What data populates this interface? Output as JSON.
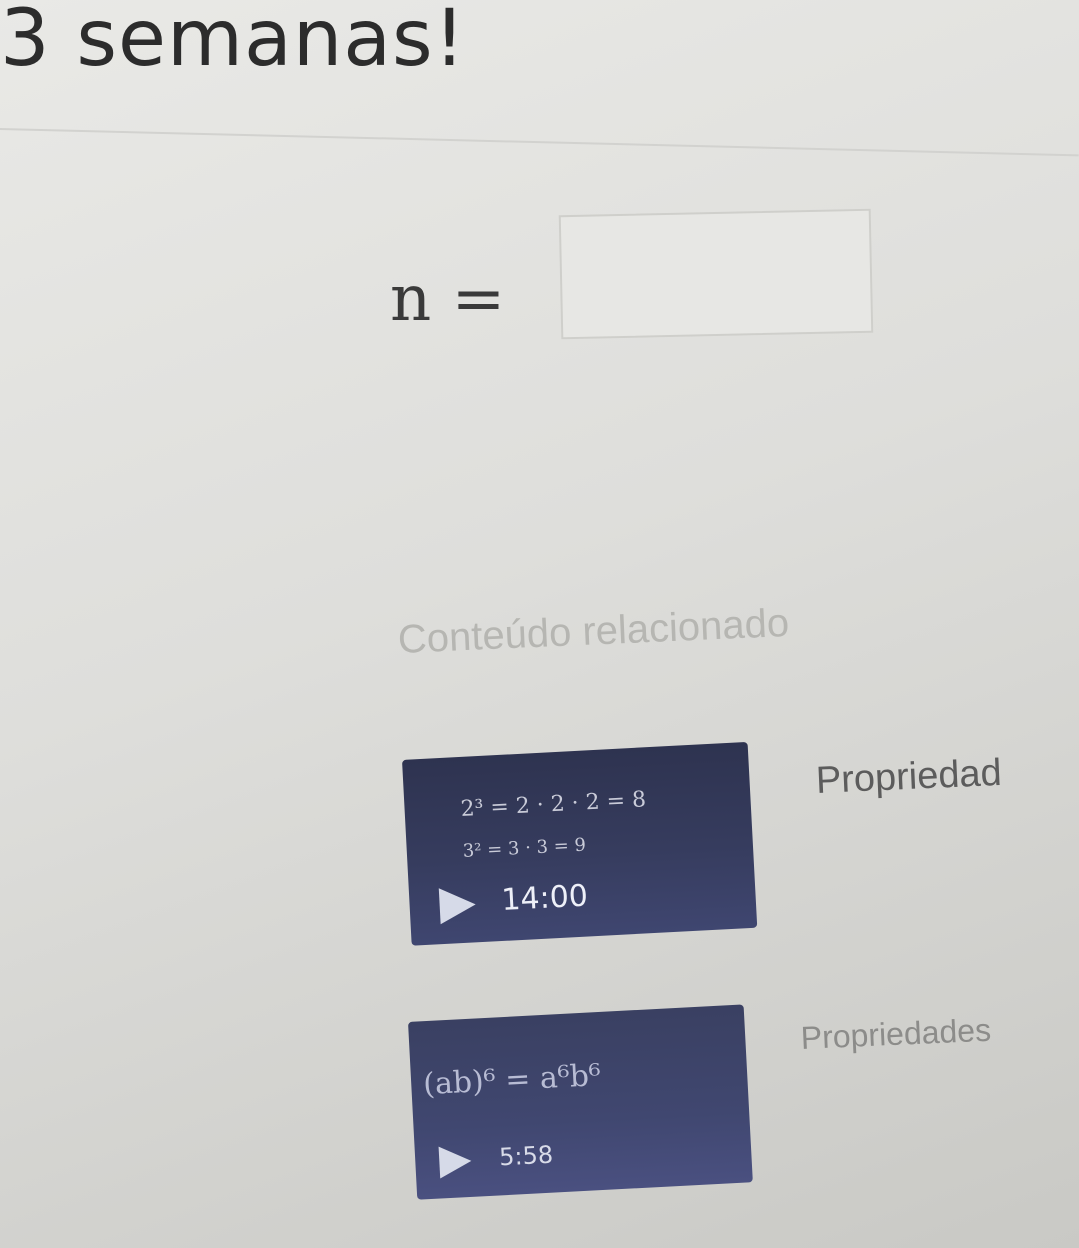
{
  "header": {
    "title": "3 semanas!"
  },
  "question": {
    "variable": "n",
    "operator": "=",
    "answer_value": ""
  },
  "related": {
    "heading": "Conteúdo relacionado",
    "videos": [
      {
        "thumbnail_lines": [
          "2³ = 2 · 2 · 2 = 8",
          "3² = 3 · 3 = 9"
        ],
        "duration": "14:00",
        "title": "Propriedad"
      },
      {
        "thumbnail_lines": [
          "(ab)⁶ = a⁶b⁶"
        ],
        "duration": "5:58",
        "title": "Propriedades"
      }
    ]
  },
  "colors": {
    "thumbnail_bg": "#363c5e",
    "page_bg": "#e1e1de"
  },
  "icons": {
    "play": "play-icon"
  }
}
